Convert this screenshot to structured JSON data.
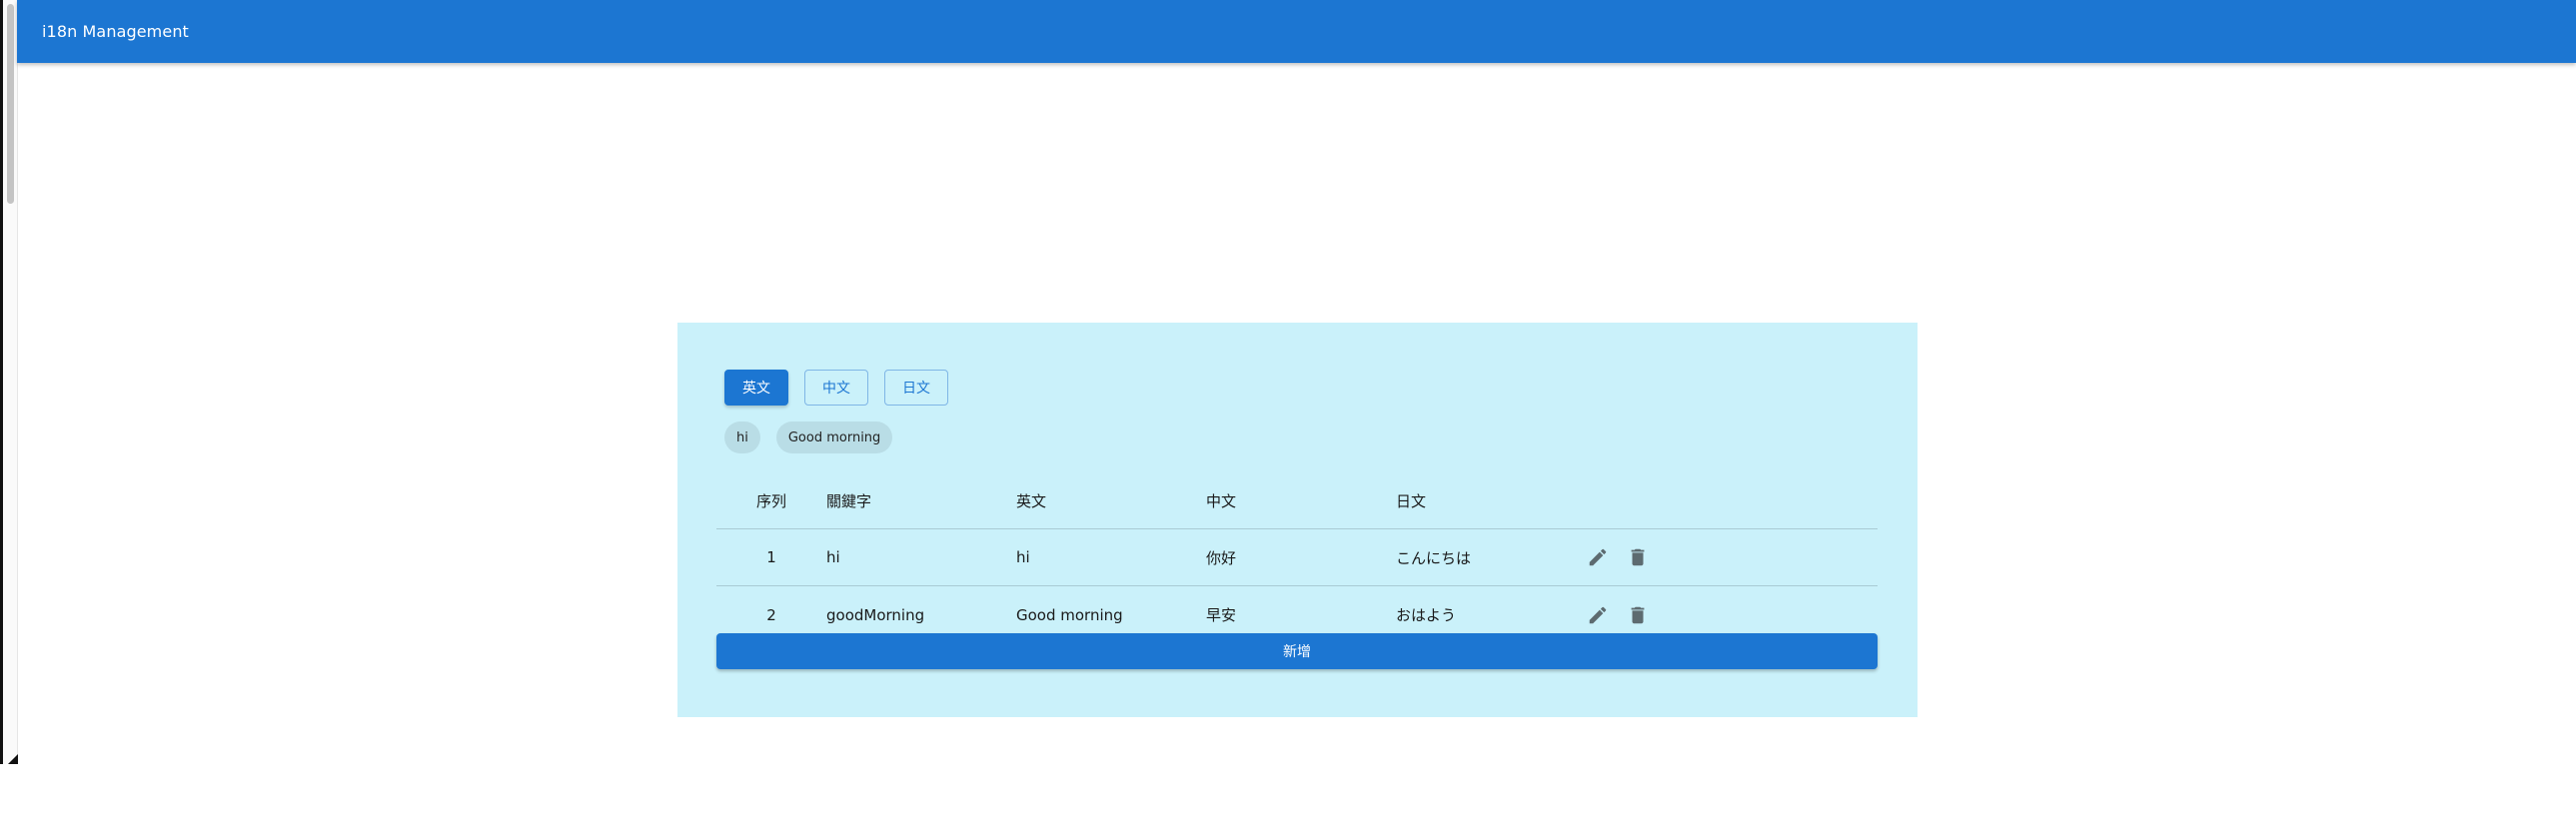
{
  "app_bar": {
    "title": "i18n Management"
  },
  "language_tabs": [
    {
      "label": "英文",
      "active": true
    },
    {
      "label": "中文",
      "active": false
    },
    {
      "label": "日文",
      "active": false
    }
  ],
  "chips": [
    "hi",
    "Good morning"
  ],
  "table": {
    "headers": {
      "index": "序列",
      "key": "關鍵字",
      "en": "英文",
      "zh": "中文",
      "ja": "日文"
    },
    "rows": [
      {
        "index": "1",
        "key": "hi",
        "en": "hi",
        "zh": "你好",
        "ja": "こんにちは"
      },
      {
        "index": "2",
        "key": "goodMorning",
        "en": "Good morning",
        "zh": "早安",
        "ja": "おはよう"
      }
    ]
  },
  "add_button": {
    "label": "新增"
  },
  "colors": {
    "primary": "#1c76d2",
    "panel_bg": "#caf1fa",
    "chip_bg": "#b9dde6",
    "icon": "#5d6b70"
  },
  "icons": {
    "edit": "pencil-icon",
    "delete": "trash-icon"
  }
}
